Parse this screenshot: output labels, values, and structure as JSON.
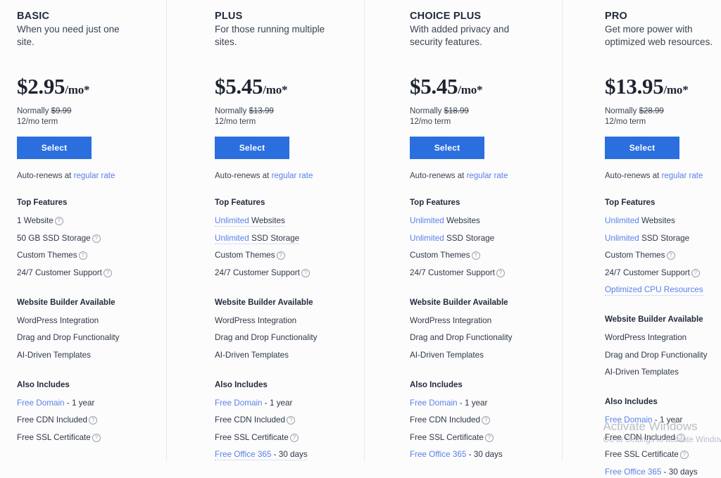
{
  "help_icon_glyph": "?",
  "colors": {
    "accent_blue": "#2b6fdf",
    "link_blue": "#5a81e8",
    "text_dark": "#2b3443",
    "divider": "#e8eaee",
    "background": "#fcfcfd",
    "watermark": "#b9bfc8"
  },
  "plans": [
    {
      "name": "BASIC",
      "tagline": "When you need just one site.",
      "price": "$2.95",
      "price_unit": "/mo*",
      "normally_label": "Normally",
      "normally_price": "$9.99",
      "term": "12/mo term",
      "select_label": "Select",
      "autorenew_prefix": "Auto-renews at",
      "autorenew_link": "regular rate",
      "groups": [
        {
          "title": "Top Features",
          "features": [
            {
              "text": "1 Website",
              "help": true
            },
            {
              "text": "50 GB SSD Storage",
              "help": true
            },
            {
              "text": "Custom Themes",
              "help": true
            },
            {
              "text": "24/7 Customer Support",
              "help": true
            }
          ]
        },
        {
          "title": "Website Builder Available",
          "features": [
            {
              "text": "WordPress Integration",
              "help": false
            },
            {
              "text": "Drag and Drop Functionality",
              "help": false
            },
            {
              "text": "AI-Driven Templates",
              "help": false
            }
          ]
        },
        {
          "title": "Also Includes",
          "features": [
            {
              "link_text": "Free Domain",
              "text": " - 1 year",
              "help": false
            },
            {
              "text": "Free CDN Included",
              "help": true
            },
            {
              "text": "Free SSL Certificate",
              "help": true
            }
          ]
        }
      ]
    },
    {
      "name": "PLUS",
      "tagline": "For those running multiple sites.",
      "price": "$5.45",
      "price_unit": "/mo*",
      "normally_label": "Normally",
      "normally_price": "$13.99",
      "term": "12/mo term",
      "select_label": "Select",
      "autorenew_prefix": "Auto-renews at",
      "autorenew_link": "regular rate",
      "groups": [
        {
          "title": "Top Features",
          "features": [
            {
              "link_text": "Unlimited",
              "text": " Websites",
              "dotted": true,
              "help": false
            },
            {
              "link_text": "Unlimited",
              "text": " SSD Storage",
              "dotted": true,
              "help": false
            },
            {
              "text": "Custom Themes",
              "help": true
            },
            {
              "text": "24/7 Customer Support",
              "help": true
            }
          ]
        },
        {
          "title": "Website Builder Available",
          "features": [
            {
              "text": "WordPress Integration",
              "help": false
            },
            {
              "text": "Drag and Drop Functionality",
              "help": false
            },
            {
              "text": "AI-Driven Templates",
              "help": false
            }
          ]
        },
        {
          "title": "Also Includes",
          "features": [
            {
              "link_text": "Free Domain",
              "text": " - 1 year",
              "help": false
            },
            {
              "text": "Free CDN Included",
              "help": true
            },
            {
              "text": "Free SSL Certificate",
              "help": true
            },
            {
              "link_text": "Free Office 365",
              "text": " - 30 days",
              "dotted": true,
              "help": false
            }
          ]
        }
      ]
    },
    {
      "name": "CHOICE PLUS",
      "tagline": "With added privacy and security features.",
      "price": "$5.45",
      "price_unit": "/mo*",
      "normally_label": "Normally",
      "normally_price": "$18.99",
      "term": "12/mo term",
      "select_label": "Select",
      "autorenew_prefix": "Auto-renews at",
      "autorenew_link": "regular rate",
      "groups": [
        {
          "title": "Top Features",
          "features": [
            {
              "link_text": "Unlimited",
              "text": " Websites",
              "help": false
            },
            {
              "link_text": "Unlimited",
              "text": " SSD Storage",
              "help": false
            },
            {
              "text": "Custom Themes",
              "help": true
            },
            {
              "text": "24/7 Customer Support",
              "help": true
            }
          ]
        },
        {
          "title": "Website Builder Available",
          "features": [
            {
              "text": "WordPress Integration",
              "help": false
            },
            {
              "text": "Drag and Drop Functionality",
              "help": false
            },
            {
              "text": "AI-Driven Templates",
              "help": false
            }
          ]
        },
        {
          "title": "Also Includes",
          "features": [
            {
              "link_text": "Free Domain",
              "text": " - 1 year",
              "help": false
            },
            {
              "text": "Free CDN Included",
              "help": true
            },
            {
              "text": "Free SSL Certificate",
              "help": true
            },
            {
              "link_text": "Free Office 365",
              "text": " - 30 days",
              "help": false
            }
          ]
        }
      ]
    },
    {
      "name": "PRO",
      "tagline": "Get more power with optimized web resources.",
      "price": "$13.95",
      "price_unit": "/mo*",
      "normally_label": "Normally",
      "normally_price": "$28.99",
      "term": "12/mo term",
      "select_label": "Select",
      "autorenew_prefix": "Auto-renews at",
      "autorenew_link": "regular rate",
      "groups": [
        {
          "title": "Top Features",
          "features": [
            {
              "link_text": "Unlimited",
              "text": " Websites",
              "help": false
            },
            {
              "link_text": "Unlimited",
              "text": " SSD Storage",
              "help": false
            },
            {
              "text": "Custom Themes",
              "help": true
            },
            {
              "text": "24/7 Customer Support",
              "help": true
            },
            {
              "link_text": "Optimized CPU Resources",
              "text": "",
              "dotted": true,
              "help": false
            }
          ]
        },
        {
          "title": "Website Builder Available",
          "features": [
            {
              "text": "WordPress Integration",
              "help": false
            },
            {
              "text": "Drag and Drop Functionality",
              "help": false
            },
            {
              "text": "AI-Driven Templates",
              "help": false
            }
          ]
        },
        {
          "title": "Also Includes",
          "features": [
            {
              "link_text": "Free Domain",
              "text": " - 1 year",
              "help": false
            },
            {
              "text": "Free CDN Included",
              "help": true
            },
            {
              "text": "Free SSL Certificate",
              "help": true
            },
            {
              "link_text": "Free Office 365",
              "text": " - 30 days",
              "help": false
            }
          ]
        }
      ]
    }
  ],
  "watermark": {
    "title": "Activate Windows",
    "subtitle": "Go to Settings to activate Windows."
  }
}
